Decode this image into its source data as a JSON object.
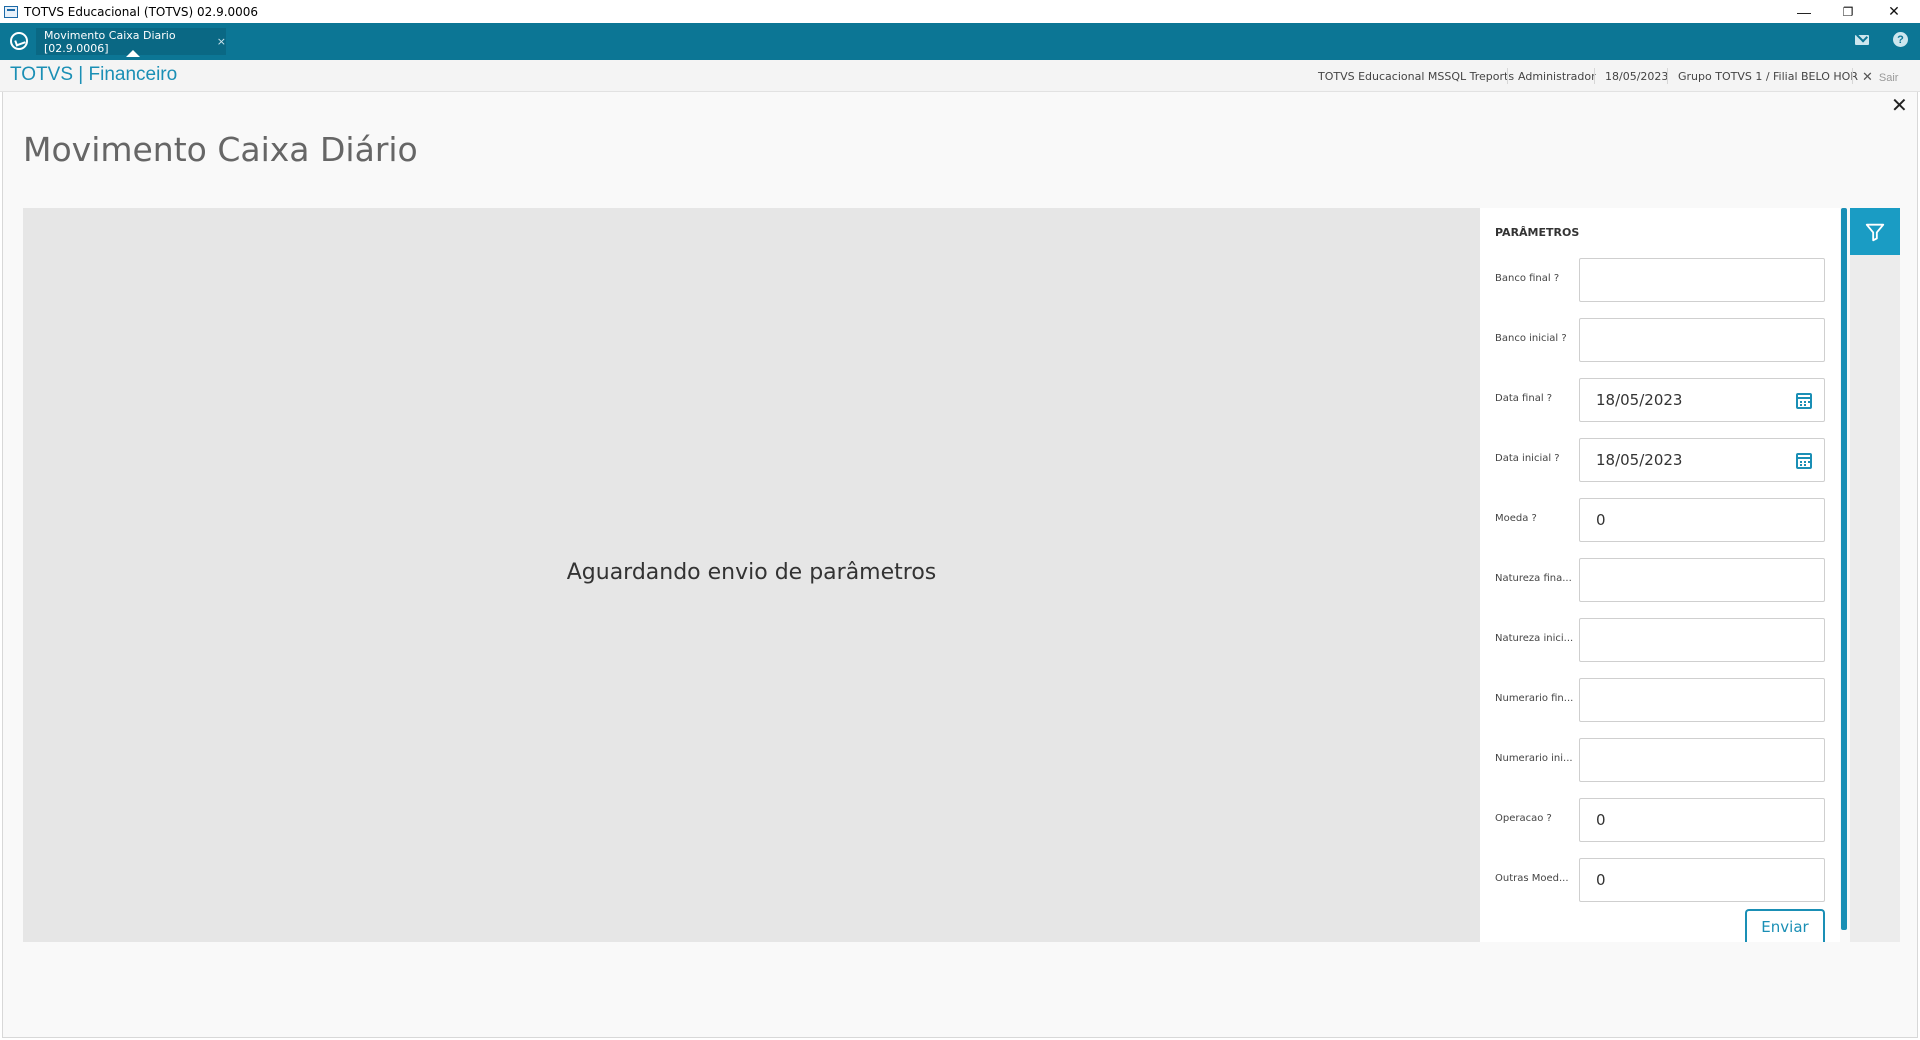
{
  "window": {
    "title": "TOTVS Educacional (TOTVS) 02.9.0006",
    "minimize": "—",
    "restore": "❐",
    "close": "✕"
  },
  "tabbar": {
    "active_tab": "Movimento Caixa Diario [02.9.0006]",
    "tab_close": "×",
    "help": "?"
  },
  "header": {
    "brand": "TOTVS | Financeiro",
    "items": [
      "TOTVS Educacional MSSQL Treports",
      "Administrador",
      "18/05/2023",
      "Grupo TOTVS 1 / Filial BELO HOR"
    ],
    "exit_label": "Sair"
  },
  "page": {
    "title": "Movimento Caixa Diário",
    "close": "✕",
    "waiting_message": "Aguardando envio de parâmetros"
  },
  "params": {
    "title": "PARÂMETROS",
    "fields": [
      {
        "label": "Banco final ?",
        "value": ""
      },
      {
        "label": "Banco inicial ?",
        "value": ""
      },
      {
        "label": "Data final ?",
        "value": "18/05/2023"
      },
      {
        "label": "Data inicial ?",
        "value": "18/05/2023"
      },
      {
        "label": "Moeda ?",
        "value": "0"
      },
      {
        "label": "Natureza fina...",
        "value": ""
      },
      {
        "label": "Natureza inici...",
        "value": ""
      },
      {
        "label": "Numerario fin...",
        "value": ""
      },
      {
        "label": "Numerario ini...",
        "value": ""
      },
      {
        "label": "Operacao ?",
        "value": "0"
      },
      {
        "label": "Outras Moed...",
        "value": "0"
      }
    ],
    "submit_label": "Enviar"
  },
  "colors": {
    "tabbar": "#0c7695",
    "accent": "#1a8fb5",
    "filter_button": "#1a9cc4"
  }
}
